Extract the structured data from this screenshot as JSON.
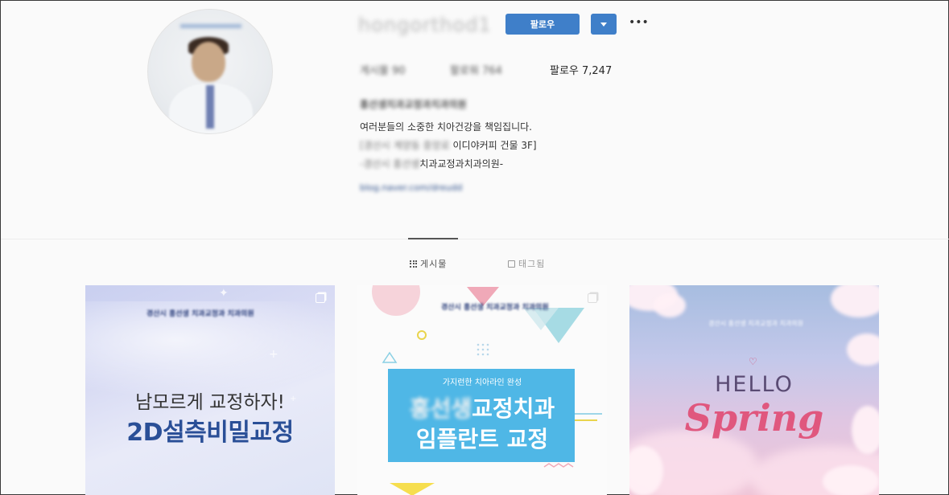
{
  "profile": {
    "username": "hongorthod1",
    "follow_label": "팔로우",
    "more_label": "•••",
    "stats": {
      "posts": "게시물 90",
      "followers": "팔로워 764",
      "following": "팔로우 7,247"
    },
    "full_name": "홍선생치과교정과치과의원",
    "bio": {
      "line1": "여러분들의 소중한 치아건강을 책임집니다.",
      "line2_blur": "[경산시 계양동 중앙로",
      "line2_rest": " 이디야커피 건물 3F]",
      "line3_blur": "-경산시 홍선생",
      "line3_rest": "치과교정과치과의원-"
    },
    "link": "blog.naver.com/dreudd"
  },
  "tabs": [
    {
      "label": "게시물",
      "icon": "grid-icon",
      "active": true
    },
    {
      "label": "태그됨",
      "icon": "tag-icon",
      "active": false
    }
  ],
  "posts": [
    {
      "clinic": "경산시 홍선생 치과교정과 치과의원",
      "line1": "남모르게 교정하자!",
      "line2": "2D설측비밀교정"
    },
    {
      "clinic": "경산시 홍선생 치과교정과 치과의원",
      "small": "가지런한 치아라인 완성",
      "big1_blur": "홍선생",
      "big1_rest": "교정치과",
      "big2": "임플란트 교정"
    },
    {
      "clinic": "경산시 홍선생 치과교정과 치과의원",
      "hello": "HELLO",
      "spring": "Spring"
    }
  ],
  "colors": {
    "follow_button": "#3f7fc9",
    "post2_box": "#4fb7e6",
    "post1_text": "#2a4f97",
    "spring_text": "#e0577e"
  }
}
